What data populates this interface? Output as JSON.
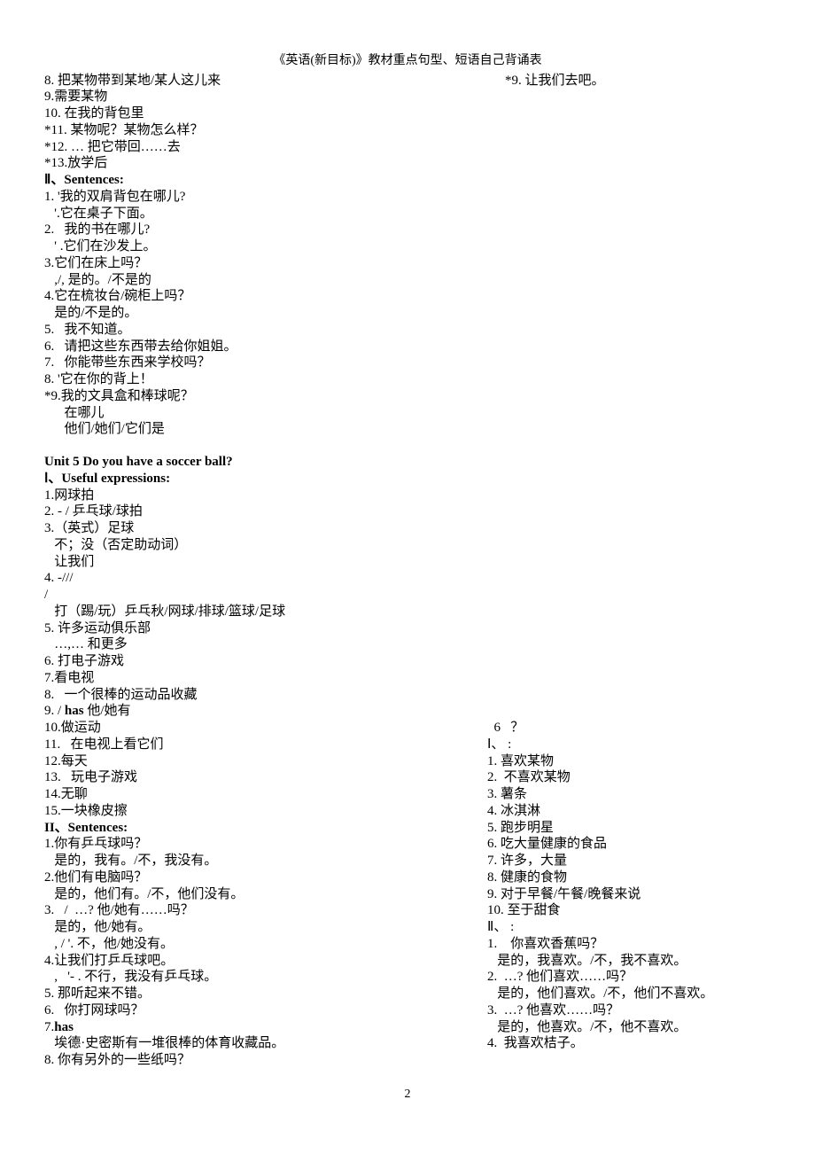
{
  "header": "《英语(新目标)》教材重点句型、短语自己背诵表",
  "topLeft": [
    "8. 把某物带到某地/某人这儿来",
    "9.需要某物",
    "10. 在我的背包里",
    "*11. 某物呢？某物怎么样？",
    "*12. … 把它带回……去",
    "*13.放学后"
  ],
  "topRight": "*9. 让我们去吧。",
  "sec2Label": "Ⅱ、Sentences:",
  "sec2": [
    "1. '我的双肩背包在哪儿?",
    "   '.它在桌子下面。",
    "2.   我的书在哪儿?",
    "   ' .它们在沙发上。",
    "3.它们在床上吗？",
    "   ,/, 是的。/不是的",
    "4.它在梳妆台/碗柜上吗？",
    "   是的/不是的。",
    "5.   我不知道。",
    "6.   请把这些东西带去给你姐姐。",
    "7.   你能带些东西来学校吗？",
    "8. '它在你的背上！",
    "*9.我的文具盒和棒球呢？",
    "      在哪儿",
    "      他们/她们/它们是"
  ],
  "unit5Title": "Unit 5    Do you have a soccer ball?",
  "unit5Sec1Label": "Ⅰ、Useful expressions:",
  "unit5Sec1": [
    "1.网球拍",
    "2. - / 乒乓球/球拍",
    "3.（英式）足球",
    "   不；没（否定助动词）",
    "   让我们",
    "4. -///",
    "/",
    "   打（踢/玩）乒乓秋/网球/排球/篮球/足球",
    "5. 许多运动俱乐部",
    "   …,… 和更多",
    "6. 打电子游戏",
    "7.看电视",
    "8.   一个很棒的运动品收藏",
    "9. / has 他/她有"
  ],
  "bottomLeft": [
    "10.做运动",
    "11.   在电视上看它们",
    "12.每天",
    "13.   玩电子游戏",
    "14.无聊",
    "15.一块橡皮擦"
  ],
  "unit5Sec2Label": "II、Sentences:",
  "unit5Sec2": [
    "1.你有乒乓球吗？",
    "   是的，我有。/不，我没有。",
    "2.他们有电脑吗？",
    "   是的，他们有。/不，他们没有。",
    "3.   /  …? 他/她有……吗？",
    "   是的，他/她有。",
    "   , / '. 不，他/她没有。",
    "4.让我们打乒乓球吧。",
    "   ,   '- . 不行，我没有乒乓球。",
    "5. 那听起来不错。",
    "6.   你打网球吗？"
  ],
  "line7has": "7.has",
  "unit5Sec2b": [
    "   埃德·史密斯有一堆很棒的体育收藏品。",
    "8. 你有另外的一些纸吗？"
  ],
  "rightColHead": "  6   ？",
  "rightSec1Label": "Ⅰ、  :",
  "rightSec1": [
    "1. 喜欢某物",
    "2.  不喜欢某物",
    "3. 薯条",
    "4. 冰淇淋",
    "5. 跑步明星",
    "6. 吃大量健康的食品",
    "7. 许多，大量",
    "8. 健康的食物",
    "9. 对于早餐/午餐/晚餐来说",
    "10. 至于甜食"
  ],
  "rightSec2Label": "Ⅱ、 :",
  "rightSec2": [
    "1.    你喜欢香蕉吗？",
    "   是的，我喜欢。/不，我不喜欢。",
    "2.  …? 他们喜欢……吗？",
    "   是的，他们喜欢。/不，他们不喜欢。",
    "3.  …? 他喜欢……吗？",
    "   是的，他喜欢。/不，他不喜欢。",
    "4.  我喜欢桔子。"
  ],
  "pageNumber": "2"
}
